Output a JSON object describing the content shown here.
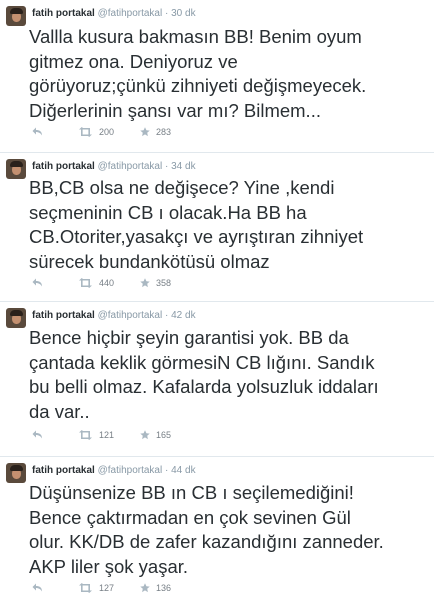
{
  "tweets": [
    {
      "name": "fatih portakal",
      "handle": "@fatihportakal",
      "separator": "·",
      "time": "30 dk",
      "lines": [
        "Vallla kusura bakmasın BB! Benim oyum",
        "gitmez ona. Deniyoruz ve",
        "görüyoruz;çünkü zihniyeti değişmeyecek.",
        "Diğerlerinin şansı var mı? Bilmem..."
      ],
      "retweets": "200",
      "favorites": "283"
    },
    {
      "name": "fatih portakal",
      "handle": "@fatihportakal",
      "separator": "·",
      "time": "34 dk",
      "lines": [
        "BB,CB olsa ne değişece? Yine ,kendi",
        "seçmeninin CB ı olacak.Ha BB ha",
        "CB.Otoriter,yasakçı ve ayrıştıran zihniyet",
        "sürecek bundankötüsü olmaz"
      ],
      "retweets": "440",
      "favorites": "358"
    },
    {
      "name": "fatih portakal",
      "handle": "@fatihportakal",
      "separator": "·",
      "time": "42 dk",
      "lines": [
        "Bence hiçbir şeyin garantisi yok. BB da",
        "çantada keklik görmesiN CB lığını. Sandık",
        "bu belli olmaz. Kafalarda yolsuzluk iddaları",
        "da var.."
      ],
      "retweets": "121",
      "favorites": "165"
    },
    {
      "name": "fatih portakal",
      "handle": "@fatihportakal",
      "separator": "·",
      "time": "44 dk",
      "lines": [
        "Düşünsenize BB ın CB ı seçilemediğini!",
        "Bence çaktırmadan en çok sevinen Gül",
        "olur. KK/DB de zafer kazandığını zanneder.",
        "AKP liler şok yaşar."
      ],
      "retweets": "127",
      "favorites": "136"
    }
  ]
}
